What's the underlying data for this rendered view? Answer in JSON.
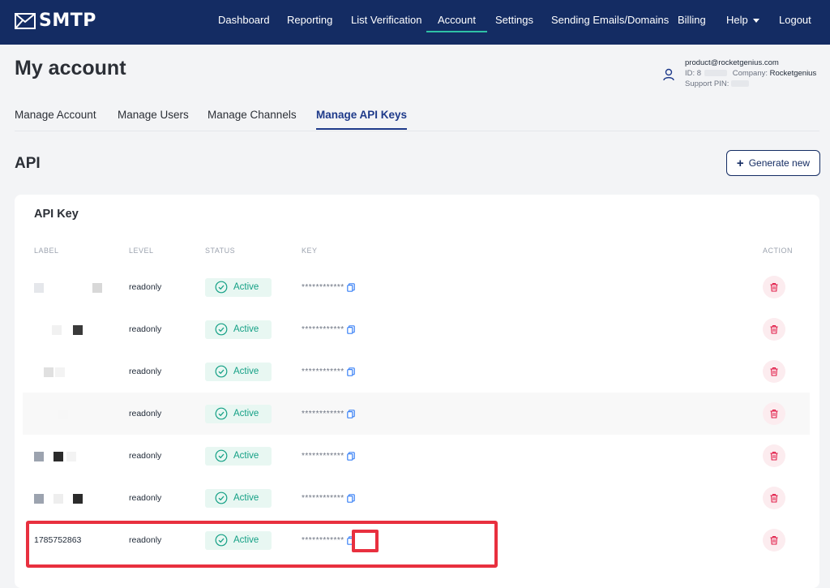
{
  "brand": {
    "name": "SMTP"
  },
  "nav": [
    {
      "label": "Dashboard",
      "active": false
    },
    {
      "label": "Reporting",
      "active": false
    },
    {
      "label": "List Verification",
      "active": false
    },
    {
      "label": "Account",
      "active": true
    },
    {
      "label": "Settings",
      "active": false
    },
    {
      "label": "Sending Emails/Domains",
      "active": false
    },
    {
      "label": "Billing",
      "active": false
    },
    {
      "label": "Help",
      "active": false
    },
    {
      "label": "Logout",
      "active": false
    }
  ],
  "page": {
    "title": "My account"
  },
  "user": {
    "email": "product@rocketgenius.com",
    "id_label": "ID: 8",
    "company_label": "Company:",
    "company": "Rocketgenius",
    "support_pin_label": "Support PIN: ",
    "support_pin_partial": "̶̶̶"
  },
  "tabs": [
    {
      "label": "Manage Account",
      "active": false
    },
    {
      "label": "Manage Users",
      "active": false
    },
    {
      "label": "Manage Channels",
      "active": false
    },
    {
      "label": "Manage API Keys",
      "active": true
    }
  ],
  "section": {
    "title": "API",
    "generate_button": "Generate new"
  },
  "card": {
    "title": "API Key",
    "columns": {
      "label": "LABEL",
      "level": "LEVEL",
      "status": "STATUS",
      "key": "KEY",
      "action": "ACTION"
    }
  },
  "rows": [
    {
      "label": "",
      "level": "readonly",
      "status": "Active",
      "key": "************"
    },
    {
      "label": "",
      "level": "readonly",
      "status": "Active",
      "key": "************"
    },
    {
      "label": "",
      "level": "readonly",
      "status": "Active",
      "key": "************"
    },
    {
      "label": "",
      "level": "readonly",
      "status": "Active",
      "key": "************"
    },
    {
      "label": "",
      "level": "readonly",
      "status": "Active",
      "key": "************"
    },
    {
      "label": "",
      "level": "readonly",
      "status": "Active",
      "key": "************"
    },
    {
      "label": "1785752863",
      "level": "readonly",
      "status": "Active",
      "key": "************"
    }
  ],
  "colors": {
    "nav_bg": "#142c63",
    "nav_active_underline": "#2fc1a6",
    "status_active": "#14a085",
    "delete": "#e11d48",
    "copy_icon": "#3b82f6",
    "highlight": "#e8303f"
  },
  "icons": {
    "logo": "envelope-icon",
    "user": "user-icon",
    "status": "check-circle-icon",
    "copy": "copy-icon",
    "delete": "trash-icon"
  }
}
